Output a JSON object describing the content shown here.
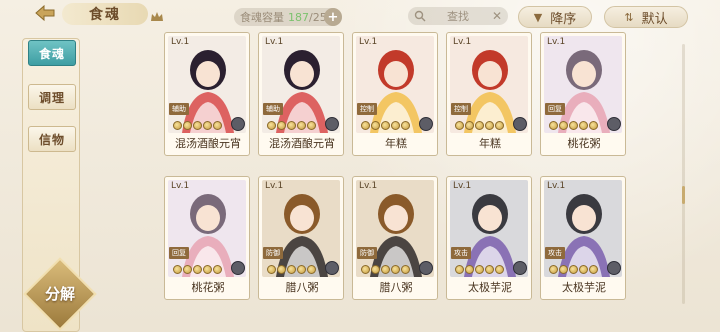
{
  "topbar": {
    "title": "食魂",
    "capacity_label": "食魂容量",
    "capacity_current": "187",
    "capacity_max": "/250",
    "search_placeholder": "查找",
    "sort_label": "降序",
    "default_label": "默认"
  },
  "sidebar": {
    "tabs": [
      "食魂",
      "调理",
      "信物"
    ],
    "decompose_label": "分解"
  },
  "cards": [
    {
      "level": "Lv.1",
      "name": "混汤酒酿元宵",
      "role": "辅助",
      "palette": [
        "#f3ece5",
        "#2b2030",
        "#d84a4a"
      ]
    },
    {
      "level": "Lv.1",
      "name": "混汤酒酿元宵",
      "role": "辅助",
      "palette": [
        "#f3ece5",
        "#2b2030",
        "#d84a4a"
      ]
    },
    {
      "level": "Lv.1",
      "name": "年糕",
      "role": "控制",
      "palette": [
        "#f6e9e0",
        "#c23a2a",
        "#f2c04c"
      ]
    },
    {
      "level": "Lv.1",
      "name": "年糕",
      "role": "控制",
      "palette": [
        "#f6e9e0",
        "#c23a2a",
        "#f2c04c"
      ]
    },
    {
      "level": "Lv.1",
      "name": "桃花粥",
      "role": "回复",
      "palette": [
        "#efe6ee",
        "#7a6a7a",
        "#e7a3b3"
      ]
    },
    {
      "level": "Lv.1",
      "name": "桃花粥",
      "role": "回复",
      "palette": [
        "#efe6ee",
        "#7a6a7a",
        "#e7a3b3"
      ]
    },
    {
      "level": "Lv.1",
      "name": "腊八粥",
      "role": "防御",
      "palette": [
        "#e9dcc7",
        "#8a5a2a",
        "#2f2a2a"
      ]
    },
    {
      "level": "Lv.1",
      "name": "腊八粥",
      "role": "防御",
      "palette": [
        "#e9dcc7",
        "#8a5a2a",
        "#2f2a2a"
      ]
    },
    {
      "level": "Lv.1",
      "name": "太极芋泥",
      "role": "攻击",
      "palette": [
        "#d9d9dc",
        "#3a3a40",
        "#7b5fae"
      ]
    },
    {
      "level": "Lv.1",
      "name": "太极芋泥",
      "role": "攻击",
      "palette": [
        "#d9d9dc",
        "#3a3a40",
        "#7b5fae"
      ]
    }
  ],
  "colors": {
    "accent": "#3e9ea3",
    "card_border": "#c9b996",
    "text_dark": "#4a3520",
    "capacity_green": "#7cc26e"
  },
  "icons": [
    "back-arrow-icon",
    "crown-icon",
    "search-icon",
    "clear-icon",
    "sort-desc-icon",
    "filter-icon",
    "gear-icon",
    "star-icon"
  ]
}
